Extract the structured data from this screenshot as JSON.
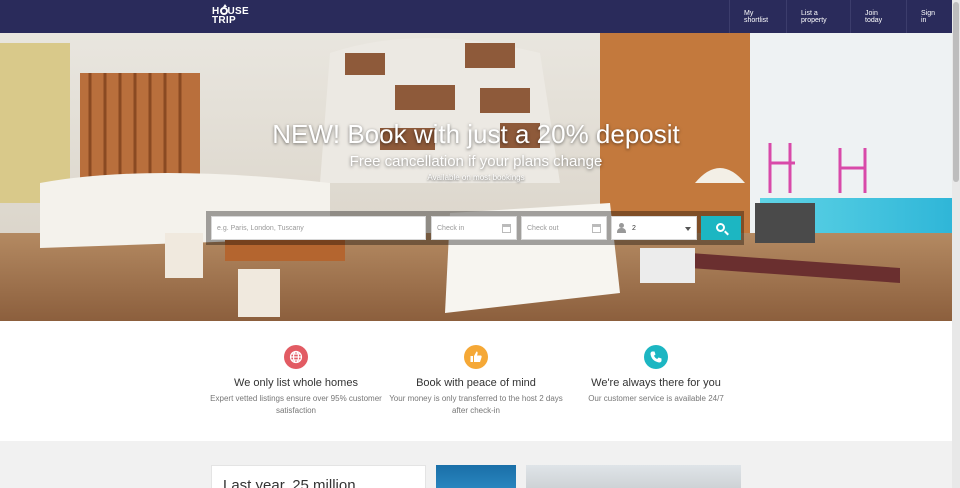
{
  "header": {
    "logo_line1": "HOUSE",
    "logo_line2": "TRIP",
    "nav": [
      "My shortlist",
      "List a property",
      "Join today",
      "Sign in"
    ]
  },
  "hero": {
    "title": "NEW! Book with just a 20% deposit",
    "subtitle": "Free cancellation if your plans change",
    "note": "Available on most bookings"
  },
  "search": {
    "destination_placeholder": "e.g. Paris, London, Tuscany",
    "checkin_placeholder": "Check in",
    "checkout_placeholder": "Check out",
    "guests_value": "2",
    "button_color": "#1cb6c2"
  },
  "features": [
    {
      "icon": "globe-icon",
      "color": "#e25b63",
      "title": "We only list whole homes",
      "text": "Expert vetted listings ensure over 95% customer satisfaction"
    },
    {
      "icon": "thumbs-up-icon",
      "color": "#f5a836",
      "title": "Book with peace of mind",
      "text": "Your money is only transferred to the host 2 days after check-in"
    },
    {
      "icon": "phone-icon",
      "color": "#1cb6c2",
      "title": "We're always there for you",
      "text": "Our customer service is available 24/7"
    }
  ],
  "promo": {
    "heading": "Last year, 25 million"
  },
  "brand_color": "#2a2b5b"
}
